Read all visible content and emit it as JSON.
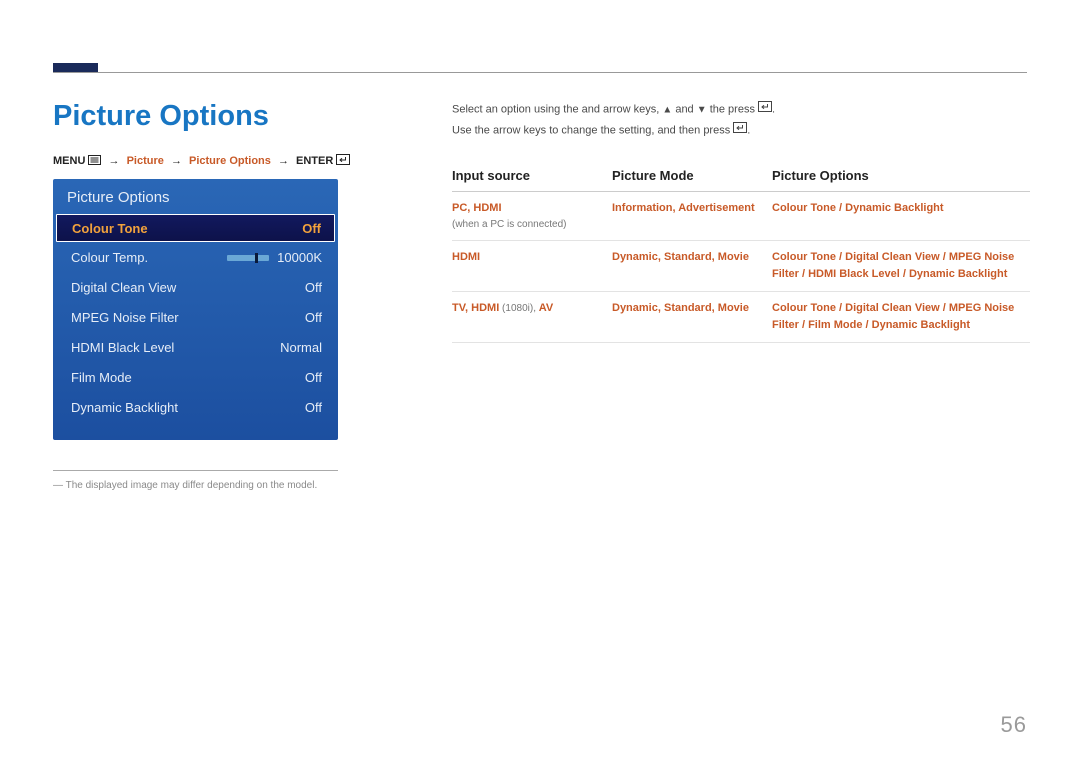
{
  "title": "Picture Options",
  "breadcrumb": {
    "menu": "MENU",
    "path1": "Picture",
    "path2": "Picture Options",
    "enter": "ENTER"
  },
  "osd": {
    "title": "Picture Options",
    "rows": [
      {
        "label": "Colour Tone",
        "value": "Off",
        "selected": true
      },
      {
        "label": "Colour Temp.",
        "value": "10000K",
        "slider": true
      },
      {
        "label": "Digital Clean View",
        "value": "Off"
      },
      {
        "label": "MPEG Noise Filter",
        "value": "Off"
      },
      {
        "label": "HDMI Black Level",
        "value": "Normal"
      },
      {
        "label": "Film Mode",
        "value": "Off"
      },
      {
        "label": "Dynamic Backlight",
        "value": "Off"
      }
    ]
  },
  "footnote": "―  The displayed image may differ depending on the model.",
  "instructions": {
    "line1a": "Select an option using the and arrow keys, ",
    "line1b": " and ",
    "line1c": " the press ",
    "line1d": ".",
    "line2a": "Use the arrow keys to change the setting, and then press ",
    "line2b": "."
  },
  "table": {
    "headers": [
      "Input source",
      "Picture Mode",
      "Picture Options"
    ],
    "rows": [
      {
        "src_parts": [
          "PC",
          ", ",
          "HDMI"
        ],
        "src_note": "(when a PC is connected)",
        "mode_parts": [
          "Information",
          ", ",
          "Advertisement"
        ],
        "opts_parts": [
          "Colour Tone",
          " / ",
          "Dynamic Backlight"
        ]
      },
      {
        "src_parts": [
          "HDMI"
        ],
        "src_note": "",
        "mode_parts": [
          "Dynamic",
          ", ",
          "Standard",
          ", ",
          "Movie"
        ],
        "opts_parts": [
          "Colour Tone",
          " / ",
          "Digital Clean View",
          " / ",
          "MPEG Noise Filter",
          " / ",
          "HDMI Black Level",
          " / ",
          "Dynamic Backlight"
        ]
      },
      {
        "src_parts": [
          "TV",
          ", ",
          "HDMI",
          " (1080i), ",
          "AV"
        ],
        "src_note": "",
        "mode_parts": [
          "Dynamic",
          ", ",
          "Standard",
          ", ",
          "Movie"
        ],
        "opts_parts": [
          "Colour Tone",
          " / ",
          "Digital Clean View",
          " / ",
          "MPEG Noise Filter",
          " / ",
          "Film Mode",
          " / ",
          "Dynamic Backlight"
        ]
      }
    ]
  },
  "page_number": "56"
}
